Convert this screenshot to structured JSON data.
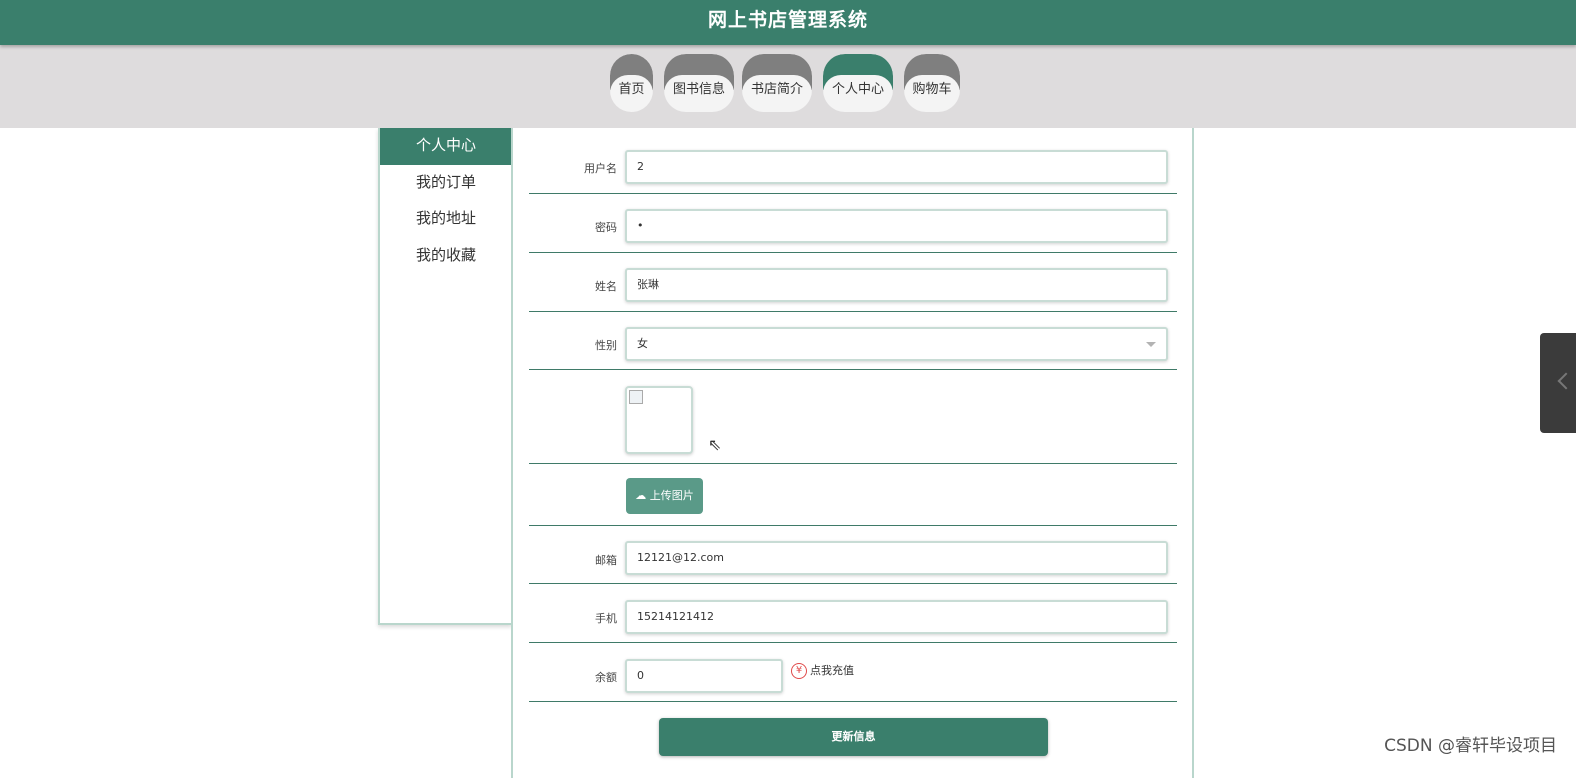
{
  "app": {
    "title": "网上书店管理系统"
  },
  "nav": {
    "items": [
      {
        "label": "首页"
      },
      {
        "label": "图书信息"
      },
      {
        "label": "书店简介"
      },
      {
        "label": "个人中心"
      },
      {
        "label": "购物车"
      }
    ],
    "active": "个人中心",
    "accent_color": "#3a7f6c",
    "inactive_color": "#7f7f7f"
  },
  "sidebar": {
    "items": [
      {
        "label": "个人中心"
      },
      {
        "label": "我的订单"
      },
      {
        "label": "我的地址"
      },
      {
        "label": "我的收藏"
      }
    ]
  },
  "form": {
    "username": {
      "label": "用户名",
      "value": "2"
    },
    "password": {
      "label": "密码",
      "value": "•"
    },
    "name": {
      "label": "姓名",
      "value": "张琳"
    },
    "gender": {
      "label": "性别",
      "value": "女"
    },
    "upload": {
      "label": "上传图片",
      "icon": "cloud-upload-icon"
    },
    "email": {
      "label": "邮箱",
      "value": "12121@12.com"
    },
    "phone": {
      "label": "手机",
      "value": "15214121412"
    },
    "balance": {
      "label": "余额",
      "value": "0",
      "recharge": "点我充值",
      "recharge_icon": "¥"
    },
    "submit": "更新信息"
  },
  "watermark": "CSDN @睿轩毕设项目"
}
